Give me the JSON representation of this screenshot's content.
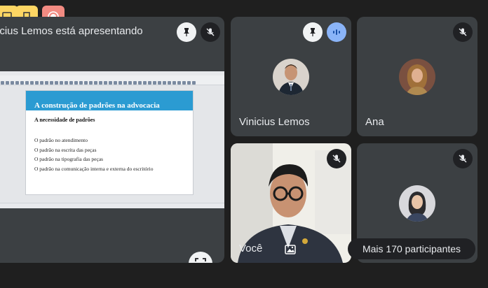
{
  "main": {
    "presenter_text": "icius Lemos está apresentando",
    "slide": {
      "title": "A construção de padrões na advocacia",
      "subtitle": "A necessidade de padrões",
      "items": [
        "O padrão no atendimento",
        "O padrão na escrita das peças",
        "O padrão na tipografia das peças",
        "O padrão na comunicação interna e externa do escritório"
      ]
    }
  },
  "participants": [
    {
      "name": "Vinicius Lemos",
      "speaking": true
    },
    {
      "name": "Ana",
      "muted": true
    },
    {
      "name": "Você",
      "muted": true
    }
  ],
  "more": {
    "label": "Mais 170 participantes"
  },
  "colors": {
    "background": "#1f1f1f",
    "tile": "#3c4043",
    "slide_title_bar": "#2b9bd2",
    "accent_blue": "#8ab4f8",
    "top_yellow": "#fdd663",
    "top_red": "#f28b82"
  },
  "icons": [
    "reactions-icon",
    "door-exit-icon",
    "record-icon",
    "pin-icon",
    "mic-off-icon",
    "audio-level-icon",
    "fullscreen-icon",
    "background-effects-icon"
  ]
}
